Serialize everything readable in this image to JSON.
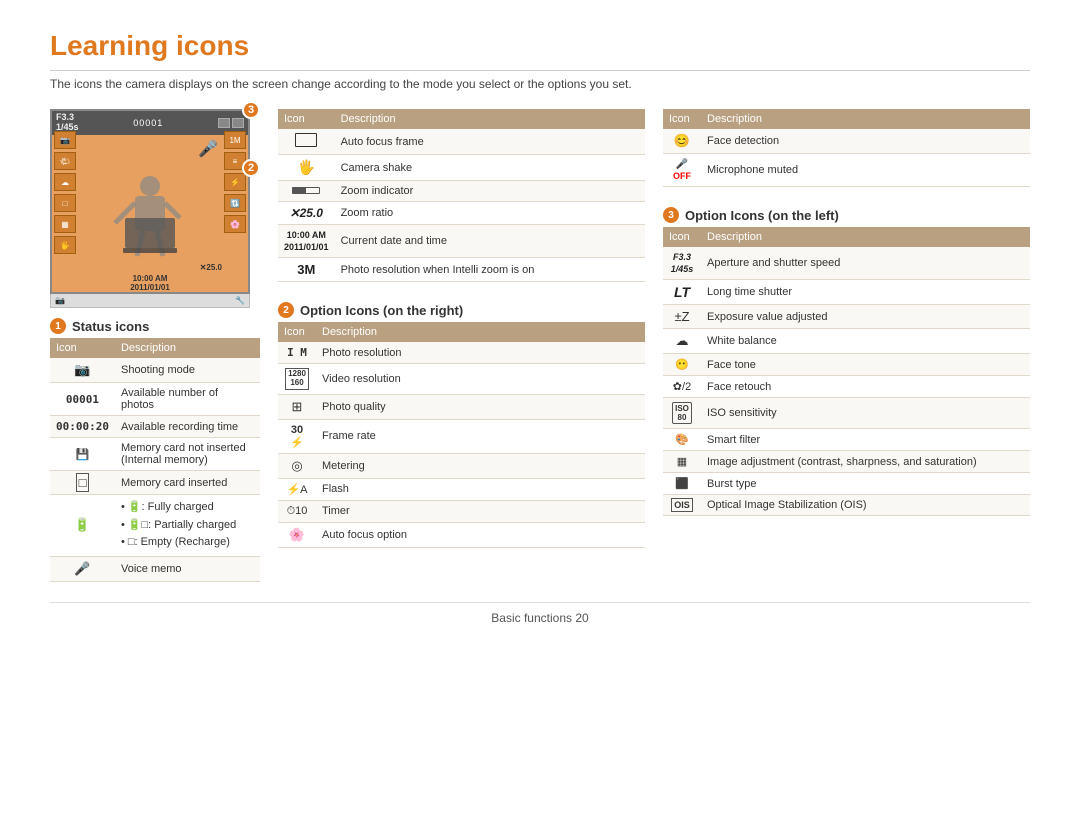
{
  "page": {
    "title": "Learning icons",
    "subtitle": "The icons the camera displays on the screen change according to the mode you select or the options you set.",
    "footer": "Basic functions  20"
  },
  "status_icons": {
    "section_label": "Status icons",
    "badge": "1",
    "headers": [
      "Icon",
      "Description"
    ],
    "rows": [
      {
        "icon": "shoot",
        "desc": "Shooting mode"
      },
      {
        "icon": "00001",
        "desc": "Available number of photos"
      },
      {
        "icon": "00:00:20",
        "desc": "Available recording time"
      },
      {
        "icon": "mem_int",
        "desc": "Memory card not inserted (Internal memory)"
      },
      {
        "icon": "mem_card",
        "desc": "Memory card inserted"
      },
      {
        "icon": "battery",
        "desc": "• 🔋: Fully charged\n• 🔋□: Partially charged\n• □: Empty (Recharge)"
      },
      {
        "icon": "voice",
        "desc": "Voice memo"
      }
    ]
  },
  "option_right": {
    "section_label": "Option Icons (on the right)",
    "badge": "2",
    "headers": [
      "Icon",
      "Description"
    ],
    "rows": [
      {
        "icon": "1m",
        "desc": "Photo resolution"
      },
      {
        "icon": "1280",
        "desc": "Video resolution"
      },
      {
        "icon": "quality",
        "desc": "Photo quality"
      },
      {
        "icon": "30fps",
        "desc": "Frame rate"
      },
      {
        "icon": "meter",
        "desc": "Metering"
      },
      {
        "icon": "flash",
        "desc": "Flash"
      },
      {
        "icon": "timer",
        "desc": "Timer"
      },
      {
        "icon": "af",
        "desc": "Auto focus option"
      }
    ]
  },
  "top_table": {
    "headers": [
      "Icon",
      "Description"
    ],
    "rows": [
      {
        "icon": "rect",
        "desc": "Auto focus frame"
      },
      {
        "icon": "hand",
        "desc": "Camera shake"
      },
      {
        "icon": "zoom_bar",
        "desc": "Zoom indicator"
      },
      {
        "icon": "x25",
        "desc": "Zoom ratio"
      },
      {
        "icon": "time",
        "desc": "Current date and time"
      },
      {
        "icon": "3m",
        "desc": "Photo resolution when Intelli zoom is on"
      }
    ]
  },
  "option_left": {
    "section_label": "Option Icons (on the left)",
    "badge": "3",
    "headers": [
      "Icon",
      "Description"
    ],
    "rows": [
      {
        "icon": "aperture",
        "desc": "Aperture and shutter speed"
      },
      {
        "icon": "lt",
        "desc": "Long time shutter"
      },
      {
        "icon": "ev",
        "desc": "Exposure value adjusted"
      },
      {
        "icon": "wb",
        "desc": "White balance"
      },
      {
        "icon": "face_tone",
        "desc": "Face tone"
      },
      {
        "icon": "face_retouch",
        "desc": "Face retouch"
      },
      {
        "icon": "iso",
        "desc": "ISO sensitivity"
      },
      {
        "icon": "smart",
        "desc": "Smart filter"
      },
      {
        "icon": "adj",
        "desc": "Image adjustment (contrast, sharpness, and saturation)"
      },
      {
        "icon": "burst",
        "desc": "Burst type"
      },
      {
        "icon": "ois",
        "desc": "Optical Image Stabilization (OIS)"
      }
    ]
  },
  "face_detection": {
    "rows": [
      {
        "icon": "face_det",
        "desc": "Face detection"
      },
      {
        "icon": "mic_off",
        "desc": "Microphone muted"
      }
    ]
  }
}
